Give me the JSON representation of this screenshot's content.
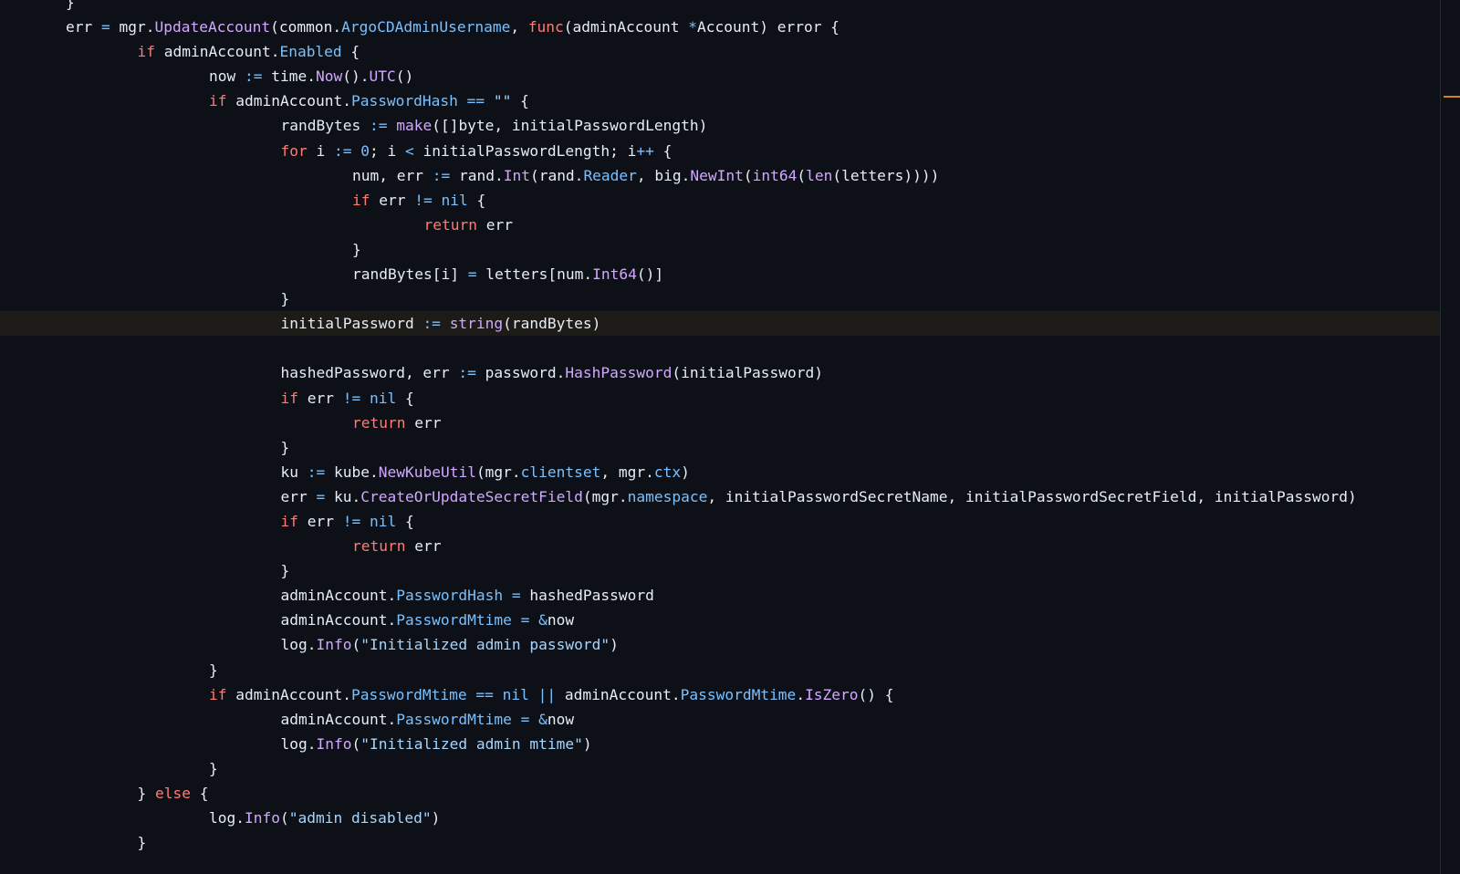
{
  "editor": {
    "current_line_index": 13,
    "colors": {
      "background": "#0d1117",
      "current_line_background": "#1c1b18",
      "keyword": "#ff7b72",
      "function": "#d2a8ff",
      "field": "#79c0ff",
      "operator": "#79c0ff",
      "string": "#a5d6ff",
      "identifier": "#e6edf3",
      "scroll_marker": "#d18616"
    },
    "lines": [
      {
        "indent": 1,
        "tokens": [
          [
            "pn",
            "}"
          ]
        ]
      },
      {
        "indent": 1,
        "tokens": [
          [
            "id",
            "err "
          ],
          [
            "op",
            "="
          ],
          [
            "id",
            " mgr."
          ],
          [
            "fn",
            "UpdateAccount"
          ],
          [
            "pn",
            "(common."
          ],
          [
            "fld",
            "ArgoCDAdminUsername"
          ],
          [
            "pn",
            ", "
          ],
          [
            "kw",
            "func"
          ],
          [
            "pn",
            "(adminAccount "
          ],
          [
            "op",
            "*"
          ],
          [
            "pn",
            "Account) error {"
          ]
        ]
      },
      {
        "indent": 2,
        "tokens": [
          [
            "kw",
            "if"
          ],
          [
            "id",
            " adminAccount."
          ],
          [
            "fld",
            "Enabled"
          ],
          [
            "pn",
            " {"
          ]
        ]
      },
      {
        "indent": 3,
        "tokens": [
          [
            "id",
            "now "
          ],
          [
            "op",
            ":="
          ],
          [
            "id",
            " time."
          ],
          [
            "fn",
            "Now"
          ],
          [
            "pn",
            "()."
          ],
          [
            "fn",
            "UTC"
          ],
          [
            "pn",
            "()"
          ]
        ]
      },
      {
        "indent": 3,
        "tokens": [
          [
            "kw",
            "if"
          ],
          [
            "id",
            " adminAccount."
          ],
          [
            "fld",
            "PasswordHash"
          ],
          [
            "pn",
            " "
          ],
          [
            "op",
            "=="
          ],
          [
            "pn",
            " "
          ],
          [
            "str",
            "\"\""
          ],
          [
            "pn",
            " {"
          ]
        ]
      },
      {
        "indent": 4,
        "tokens": [
          [
            "id",
            "randBytes "
          ],
          [
            "op",
            ":="
          ],
          [
            "pn",
            " "
          ],
          [
            "fn",
            "make"
          ],
          [
            "pn",
            "([]byte, initialPasswordLength)"
          ]
        ]
      },
      {
        "indent": 4,
        "tokens": [
          [
            "kw",
            "for"
          ],
          [
            "id",
            " i "
          ],
          [
            "op",
            ":="
          ],
          [
            "pn",
            " "
          ],
          [
            "num",
            "0"
          ],
          [
            "pn",
            "; i "
          ],
          [
            "op",
            "<"
          ],
          [
            "pn",
            " initialPasswordLength; i"
          ],
          [
            "op",
            "++"
          ],
          [
            "pn",
            " {"
          ]
        ]
      },
      {
        "indent": 5,
        "tokens": [
          [
            "id",
            "num, err "
          ],
          [
            "op",
            ":="
          ],
          [
            "id",
            " rand."
          ],
          [
            "fn",
            "Int"
          ],
          [
            "pn",
            "(rand."
          ],
          [
            "fld",
            "Reader"
          ],
          [
            "pn",
            ", big."
          ],
          [
            "fn",
            "NewInt"
          ],
          [
            "pn",
            "("
          ],
          [
            "fn",
            "int64"
          ],
          [
            "pn",
            "("
          ],
          [
            "fn",
            "len"
          ],
          [
            "pn",
            "(letters))))"
          ]
        ]
      },
      {
        "indent": 5,
        "tokens": [
          [
            "kw",
            "if"
          ],
          [
            "id",
            " err "
          ],
          [
            "op",
            "!="
          ],
          [
            "pn",
            " "
          ],
          [
            "num",
            "nil"
          ],
          [
            "pn",
            " {"
          ]
        ]
      },
      {
        "indent": 6,
        "tokens": [
          [
            "kw",
            "return"
          ],
          [
            "id",
            " err"
          ]
        ]
      },
      {
        "indent": 5,
        "tokens": [
          [
            "pn",
            "}"
          ]
        ]
      },
      {
        "indent": 5,
        "tokens": [
          [
            "id",
            "randBytes[i] "
          ],
          [
            "op",
            "="
          ],
          [
            "id",
            " letters[num."
          ],
          [
            "fn",
            "Int64"
          ],
          [
            "pn",
            "()]"
          ]
        ]
      },
      {
        "indent": 4,
        "tokens": [
          [
            "pn",
            "}"
          ]
        ]
      },
      {
        "indent": 4,
        "tokens": [
          [
            "id",
            "initialPassword "
          ],
          [
            "op",
            ":="
          ],
          [
            "pn",
            " "
          ],
          [
            "fn",
            "string"
          ],
          [
            "pn",
            "(randBytes)"
          ]
        ]
      },
      {
        "indent": 0,
        "tokens": []
      },
      {
        "indent": 4,
        "tokens": [
          [
            "id",
            "hashedPassword, err "
          ],
          [
            "op",
            ":="
          ],
          [
            "id",
            " password."
          ],
          [
            "fn",
            "HashPassword"
          ],
          [
            "pn",
            "(initialPassword)"
          ]
        ]
      },
      {
        "indent": 4,
        "tokens": [
          [
            "kw",
            "if"
          ],
          [
            "id",
            " err "
          ],
          [
            "op",
            "!="
          ],
          [
            "pn",
            " "
          ],
          [
            "num",
            "nil"
          ],
          [
            "pn",
            " {"
          ]
        ]
      },
      {
        "indent": 5,
        "tokens": [
          [
            "kw",
            "return"
          ],
          [
            "id",
            " err"
          ]
        ]
      },
      {
        "indent": 4,
        "tokens": [
          [
            "pn",
            "}"
          ]
        ]
      },
      {
        "indent": 4,
        "tokens": [
          [
            "id",
            "ku "
          ],
          [
            "op",
            ":="
          ],
          [
            "id",
            " kube."
          ],
          [
            "fn",
            "NewKubeUtil"
          ],
          [
            "pn",
            "(mgr."
          ],
          [
            "fld",
            "clientset"
          ],
          [
            "pn",
            ", mgr."
          ],
          [
            "fld",
            "ctx"
          ],
          [
            "pn",
            ")"
          ]
        ]
      },
      {
        "indent": 4,
        "tokens": [
          [
            "id",
            "err "
          ],
          [
            "op",
            "="
          ],
          [
            "id",
            " ku."
          ],
          [
            "fn",
            "CreateOrUpdateSecretField"
          ],
          [
            "pn",
            "(mgr."
          ],
          [
            "fld",
            "namespace"
          ],
          [
            "pn",
            ", initialPasswordSecretName, initialPasswordSecretField, initialPassword)"
          ]
        ]
      },
      {
        "indent": 4,
        "tokens": [
          [
            "kw",
            "if"
          ],
          [
            "id",
            " err "
          ],
          [
            "op",
            "!="
          ],
          [
            "pn",
            " "
          ],
          [
            "num",
            "nil"
          ],
          [
            "pn",
            " {"
          ]
        ]
      },
      {
        "indent": 5,
        "tokens": [
          [
            "kw",
            "return"
          ],
          [
            "id",
            " err"
          ]
        ]
      },
      {
        "indent": 4,
        "tokens": [
          [
            "pn",
            "}"
          ]
        ]
      },
      {
        "indent": 4,
        "tokens": [
          [
            "id",
            "adminAccount."
          ],
          [
            "fld",
            "PasswordHash"
          ],
          [
            "pn",
            " "
          ],
          [
            "op",
            "="
          ],
          [
            "id",
            " hashedPassword"
          ]
        ]
      },
      {
        "indent": 4,
        "tokens": [
          [
            "id",
            "adminAccount."
          ],
          [
            "fld",
            "PasswordMtime"
          ],
          [
            "pn",
            " "
          ],
          [
            "op",
            "="
          ],
          [
            "pn",
            " "
          ],
          [
            "op",
            "&"
          ],
          [
            "id",
            "now"
          ]
        ]
      },
      {
        "indent": 4,
        "tokens": [
          [
            "id",
            "log."
          ],
          [
            "fn",
            "Info"
          ],
          [
            "pn",
            "("
          ],
          [
            "str",
            "\"Initialized admin password\""
          ],
          [
            "pn",
            ")"
          ]
        ]
      },
      {
        "indent": 3,
        "tokens": [
          [
            "pn",
            "}"
          ]
        ]
      },
      {
        "indent": 3,
        "tokens": [
          [
            "kw",
            "if"
          ],
          [
            "id",
            " adminAccount."
          ],
          [
            "fld",
            "PasswordMtime"
          ],
          [
            "pn",
            " "
          ],
          [
            "op",
            "=="
          ],
          [
            "pn",
            " "
          ],
          [
            "num",
            "nil"
          ],
          [
            "pn",
            " "
          ],
          [
            "op",
            "||"
          ],
          [
            "id",
            " adminAccount."
          ],
          [
            "fld",
            "PasswordMtime"
          ],
          [
            "pn",
            "."
          ],
          [
            "fn",
            "IsZero"
          ],
          [
            "pn",
            "() {"
          ]
        ]
      },
      {
        "indent": 4,
        "tokens": [
          [
            "id",
            "adminAccount."
          ],
          [
            "fld",
            "PasswordMtime"
          ],
          [
            "pn",
            " "
          ],
          [
            "op",
            "="
          ],
          [
            "pn",
            " "
          ],
          [
            "op",
            "&"
          ],
          [
            "id",
            "now"
          ]
        ]
      },
      {
        "indent": 4,
        "tokens": [
          [
            "id",
            "log."
          ],
          [
            "fn",
            "Info"
          ],
          [
            "pn",
            "("
          ],
          [
            "str",
            "\"Initialized admin mtime\""
          ],
          [
            "pn",
            ")"
          ]
        ]
      },
      {
        "indent": 3,
        "tokens": [
          [
            "pn",
            "}"
          ]
        ]
      },
      {
        "indent": 2,
        "tokens": [
          [
            "pn",
            "} "
          ],
          [
            "kw",
            "else"
          ],
          [
            "pn",
            " {"
          ]
        ]
      },
      {
        "indent": 3,
        "tokens": [
          [
            "id",
            "log."
          ],
          [
            "fn",
            "Info"
          ],
          [
            "pn",
            "("
          ],
          [
            "str",
            "\"admin disabled\""
          ],
          [
            "pn",
            ")"
          ]
        ]
      },
      {
        "indent": 2,
        "tokens": [
          [
            "pn",
            "}"
          ]
        ]
      }
    ]
  }
}
